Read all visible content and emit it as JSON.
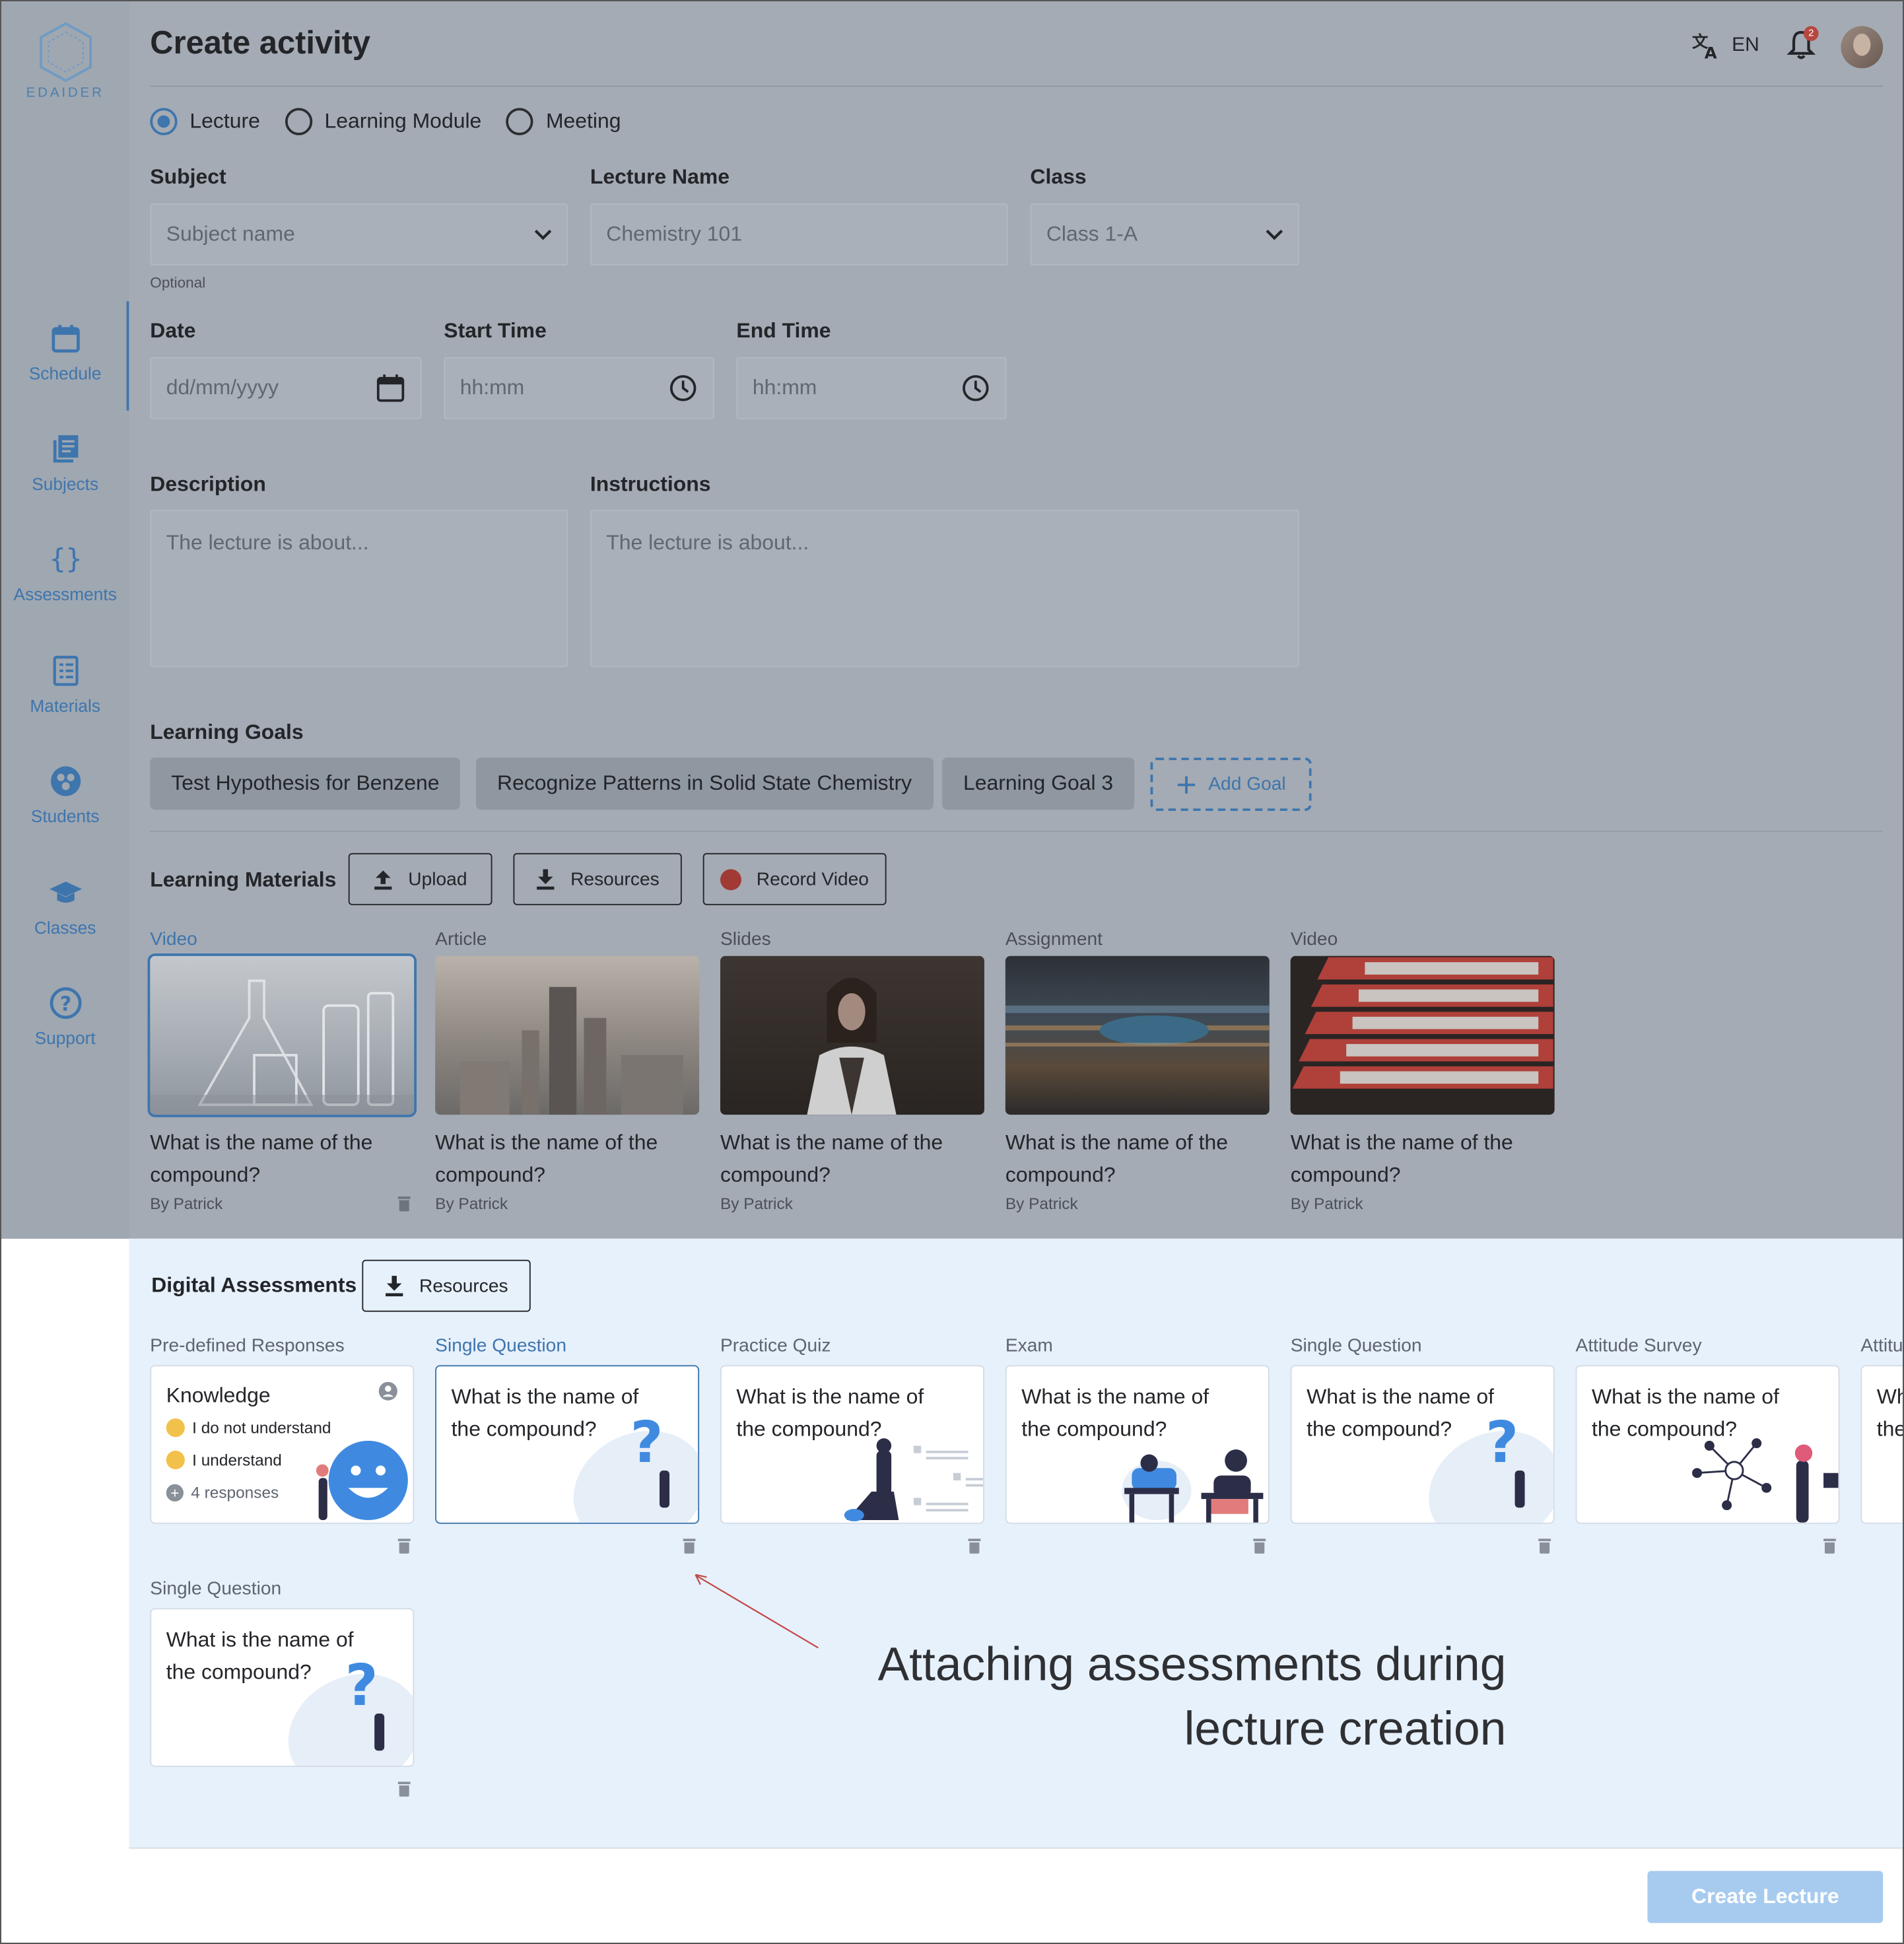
{
  "app": {
    "logo_text": "EDAIDER",
    "title": "Create activity"
  },
  "topbar": {
    "language": "EN",
    "notification_count": "2"
  },
  "sidebar": {
    "items": [
      {
        "label": "Schedule",
        "icon": "calendar-icon",
        "active": true
      },
      {
        "label": "Subjects",
        "icon": "books-icon"
      },
      {
        "label": "Assessments",
        "icon": "braces-icon"
      },
      {
        "label": "Materials",
        "icon": "document-icon"
      },
      {
        "label": "Students",
        "icon": "students-icon"
      },
      {
        "label": "Classes",
        "icon": "graduation-cap-icon"
      },
      {
        "label": "Support",
        "icon": "help-icon"
      }
    ]
  },
  "activity_types": [
    "Lecture",
    "Learning Module",
    "Meeting"
  ],
  "selected_type": "Lecture",
  "form": {
    "subject": {
      "label": "Subject",
      "placeholder": "Subject name",
      "hint": "Optional"
    },
    "lecture_name": {
      "label": "Lecture Name",
      "placeholder": "Chemistry 101"
    },
    "class": {
      "label": "Class",
      "value": "Class 1-A"
    },
    "date": {
      "label": "Date",
      "placeholder": "dd/mm/yyyy"
    },
    "start_time": {
      "label": "Start Time",
      "placeholder": "hh:mm"
    },
    "end_time": {
      "label": "End Time",
      "placeholder": "hh:mm"
    },
    "description": {
      "label": "Description",
      "placeholder": "The lecture is about..."
    },
    "instructions": {
      "label": "Instructions",
      "placeholder": "The lecture is about..."
    }
  },
  "learning_goals": {
    "label": "Learning Goals",
    "goals": [
      "Test Hypothesis for Benzene",
      "Recognize Patterns in Solid State Chemistry",
      "Learning Goal 3"
    ],
    "add_label": "Add Goal"
  },
  "learning_materials": {
    "label": "Learning Materials",
    "buttons": {
      "upload": "Upload",
      "resources": "Resources",
      "record": "Record Video"
    },
    "items": [
      {
        "type": "Video",
        "title": "What is the name of the compound?",
        "author": "By Patrick",
        "selected": true
      },
      {
        "type": "Article",
        "title": "What is the name of the compound?",
        "author": "By Patrick"
      },
      {
        "type": "Slides",
        "title": "What is the name of the compound?",
        "author": "By Patrick"
      },
      {
        "type": "Assignment",
        "title": "What is the name of the compound?",
        "author": "By Patrick"
      },
      {
        "type": "Video",
        "title": "What is the name of the compound?",
        "author": "By Patrick"
      }
    ]
  },
  "digital_assessments": {
    "label": "Digital Assessments",
    "resources_label": "Resources",
    "items": [
      {
        "type": "Pre-defined Responses",
        "title": "Knowledge",
        "responses": [
          "I do not understand",
          "I understand"
        ],
        "count": "4 responses"
      },
      {
        "type": "Single Question",
        "title": "What is the name of the compound?",
        "selected": true
      },
      {
        "type": "Practice Quiz",
        "title": "What is the name of the compound?"
      },
      {
        "type": "Exam",
        "title": "What is the name of the compound?"
      },
      {
        "type": "Single Question",
        "title": "What is the name of the compound?"
      },
      {
        "type": "Attitude Survey",
        "title": "What is the name of the compound?"
      },
      {
        "type": "Attitu",
        "title": "Wh the"
      },
      {
        "type": "Single Question",
        "title": "What is the name of the compound?"
      }
    ]
  },
  "annotation": {
    "line1": "Attaching assessments during",
    "line2": "lecture creation"
  },
  "footer": {
    "create_label": "Create Lecture"
  }
}
